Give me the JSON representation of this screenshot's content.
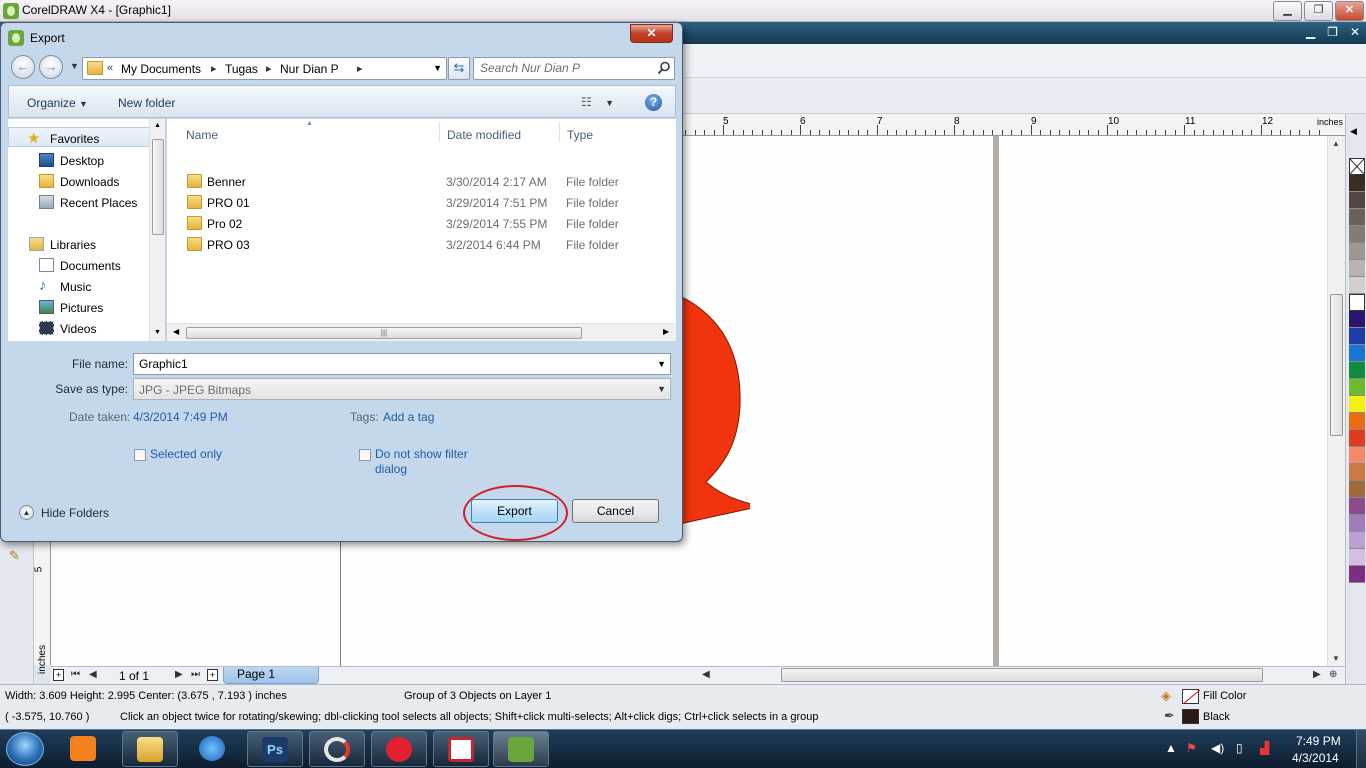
{
  "app": {
    "title": "CorelDRAW X4 - [Graphic1]",
    "controls": {
      "minimize": "▁",
      "restore": "❐",
      "close": "✕"
    }
  },
  "ruler": {
    "top_labels": [
      "5",
      "6",
      "7",
      "8",
      "9",
      "10",
      "11",
      "12"
    ],
    "units": "inches",
    "left_label": "5",
    "left_units": "inches"
  },
  "page_nav": {
    "count": "1 of 1",
    "tab": "Page 1"
  },
  "status": {
    "dimensions": "Width: 3.609  Height: 2.995  Center: (3.675 , 7.193 )  inches",
    "object_info": "Group of 3 Objects on Layer 1",
    "coords": "( -3.575, 10.760 )",
    "hint": "Click an object twice for rotating/skewing; dbl-clicking tool selects all objects; Shift+click multi-selects; Alt+click digs; Ctrl+click selects in a group",
    "fill_label": "Fill Color",
    "outline_label": "Black"
  },
  "palette_colors": [
    "#ffffff",
    "#3a2d24",
    "#524840",
    "#6a615a",
    "#837b76",
    "#9d9793",
    "#b8b3b0",
    "#d2cfcd",
    "#ffffff",
    "#2a1670",
    "#1d3ea8",
    "#1976d2",
    "#108c3e",
    "#6cba2d",
    "#f5ee12",
    "#ef6b12",
    "#e23a1e",
    "#f48a6a",
    "#c97a44",
    "#a26a3b",
    "#8c4b8f",
    "#a17cbd",
    "#bba0d2",
    "#d5bde3",
    "#7b2e83"
  ],
  "dialog": {
    "title": "Export",
    "close": "✕",
    "breadcrumb": {
      "prefix": "«",
      "parts": [
        "My Documents",
        "Tugas",
        "Nur Dian P"
      ]
    },
    "search_placeholder": "Search Nur Dian P",
    "organize": "Organize",
    "new_folder": "New folder",
    "help": "?",
    "nav": {
      "favorites": "Favorites",
      "favorites_items": [
        "Desktop",
        "Downloads",
        "Recent Places"
      ],
      "libraries": "Libraries",
      "libraries_items": [
        "Documents",
        "Music",
        "Pictures",
        "Videos"
      ]
    },
    "columns": {
      "name": "Name",
      "date": "Date modified",
      "type": "Type"
    },
    "files": [
      {
        "name": "Benner",
        "date": "3/30/2014 2:17 AM",
        "type": "File folder"
      },
      {
        "name": "PRO 01",
        "date": "3/29/2014 7:51 PM",
        "type": "File folder"
      },
      {
        "name": "Pro 02",
        "date": "3/29/2014 7:55 PM",
        "type": "File folder"
      },
      {
        "name": "PRO 03",
        "date": "3/2/2014 6:44 PM",
        "type": "File folder"
      }
    ],
    "file_name_label": "File name:",
    "file_name_value": "Graphic1",
    "save_type_label": "Save as type:",
    "save_type_value": "JPG - JPEG Bitmaps",
    "date_taken_label": "Date taken:",
    "date_taken_value": "4/3/2014 7:49 PM",
    "tags_label": "Tags:",
    "tags_value": "Add a tag",
    "selected_only": "Selected only",
    "no_filter_line1": "Do not show filter",
    "no_filter_line2": "dialog",
    "hide_folders": "Hide Folders",
    "export_button": "Export",
    "cancel_button": "Cancel"
  },
  "taskbar": {
    "time": "7:49 PM",
    "date": "4/3/2014"
  }
}
